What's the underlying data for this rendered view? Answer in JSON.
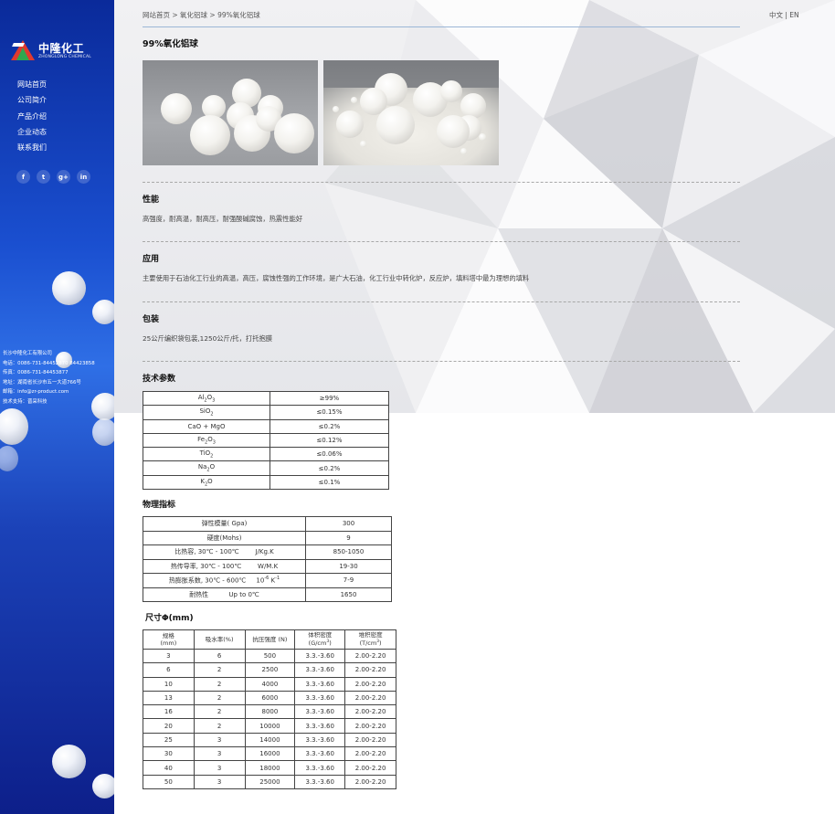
{
  "sidebar": {
    "logo_cn": "中隆化工",
    "logo_en": "ZHONGLONG CHEMICAL",
    "nav": [
      "网站首页",
      "公司简介",
      "产品介绍",
      "企业动态",
      "联系我们"
    ],
    "social": [
      "f",
      "t",
      "g+",
      "in"
    ],
    "contact": [
      "长沙中隆化工有限公司",
      "电话：0086-731-84452870 84423858",
      "传真：0086-731-84453877",
      "地址：湖南省长沙市五一大道766号",
      "邮箱：info@zr-product.com",
      "技术支持：晋采科技"
    ]
  },
  "breadcrumb": "网站首页 > 氧化铝球 > 99%氧化铝球",
  "lang": "中文 | EN",
  "page_title": "99%氧化铝球",
  "sections": {
    "performance": {
      "title": "性能",
      "text": "高强度，耐高温，耐高压，耐强酸碱腐蚀，热震性能好"
    },
    "application": {
      "title": "应用",
      "text": "主要使用于石油化工行业的高温，高压，腐蚀性强的工作环境，是广大石油，化工行业中转化炉，反应炉，填料塔中最为理想的填料"
    },
    "packaging": {
      "title": "包装",
      "text": "25公斤编织袋包装,1250公斤/托，打托抱膜"
    },
    "tech_title": "技术参数",
    "phys_title": "物理指标",
    "size_title": "尺寸Φ(mm)"
  },
  "tech_params": [
    {
      "base": "Al",
      "sub": "2",
      "base2": "O",
      "sub2": "3",
      "value": "≥99%"
    },
    {
      "base": "SiO",
      "sub": "2",
      "base2": "",
      "sub2": "",
      "value": "≤0.15%"
    },
    {
      "base": "CaO + MgO",
      "sub": "",
      "base2": "",
      "sub2": "",
      "value": "≤0.2%"
    },
    {
      "base": "Fe",
      "sub": "2",
      "base2": "O",
      "sub2": "3",
      "value": "≤0.12%"
    },
    {
      "base": "TiO",
      "sub": "2",
      "base2": "",
      "sub2": "",
      "value": "≤0.06%"
    },
    {
      "base": "Na",
      "sub": "2",
      "base2": "O",
      "sub2": "",
      "value": "≤0.2%"
    },
    {
      "base": "K",
      "sub": "2",
      "base2": "O",
      "sub2": "",
      "value": "≤0.1%"
    }
  ],
  "phys_params": [
    {
      "label": "弹性模量( Gpa)",
      "value": "300"
    },
    {
      "label": "硬度(Mohs)",
      "value": "9"
    },
    {
      "label": "比热容, 30℃ - 100℃        J/Kg.K",
      "value": "850-1050"
    },
    {
      "label": "热传导率, 30℃ - 100℃        W/M.K",
      "value": "19-30"
    },
    {
      "label_pre": "热膨胀系数, 30℃ - 600℃     10",
      "sup": "-6",
      "label_post": " K",
      "sup2": "-1",
      "value": "7-9"
    },
    {
      "label": "耐热性          Up to 0℃",
      "value": "1650"
    }
  ],
  "size_headers": [
    {
      "l1": "规格",
      "l2": "(mm)"
    },
    {
      "l1": "吸水率(%)",
      "l2": ""
    },
    {
      "l1": "抗压强度 (N)",
      "l2": ""
    },
    {
      "l1": "体积密度",
      "l2": "(G/cm",
      "sup": "3",
      "close": ")"
    },
    {
      "l1": "堆积密度",
      "l2": "(T/cm",
      "sup": "3",
      "close": ")"
    }
  ],
  "size_rows": [
    [
      "3",
      "6",
      "500",
      "3.3.-3.60",
      "2.00-2.20"
    ],
    [
      "6",
      "2",
      "2500",
      "3.3.-3.60",
      "2.00-2.20"
    ],
    [
      "10",
      "2",
      "4000",
      "3.3.-3.60",
      "2.00-2.20"
    ],
    [
      "13",
      "2",
      "6000",
      "3.3.-3.60",
      "2.00-2.20"
    ],
    [
      "16",
      "2",
      "8000",
      "3.3.-3.60",
      "2.00-2.20"
    ],
    [
      "20",
      "2",
      "10000",
      "3.3.-3.60",
      "2.00-2.20"
    ],
    [
      "25",
      "3",
      "14000",
      "3.3.-3.60",
      "2.00-2.20"
    ],
    [
      "30",
      "3",
      "16000",
      "3.3.-3.60",
      "2.00-2.20"
    ],
    [
      "40",
      "3",
      "18000",
      "3.3.-3.60",
      "2.00-2.20"
    ],
    [
      "50",
      "3",
      "25000",
      "3.3.-3.60",
      "2.00-2.20"
    ]
  ]
}
